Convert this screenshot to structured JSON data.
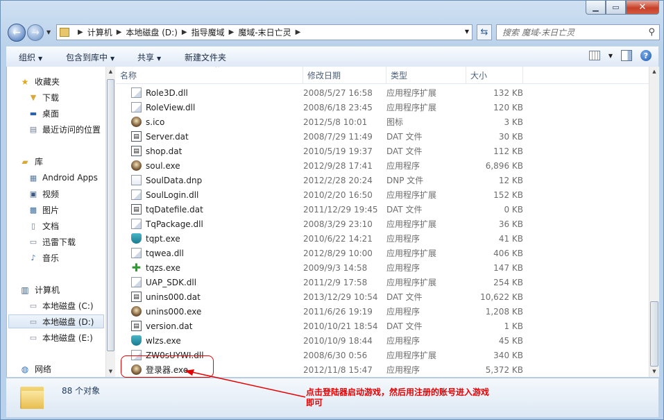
{
  "window": {
    "caption_min": "0",
    "caption_max": "1",
    "caption_close": "r"
  },
  "nav": {
    "breadcrumbs": [
      "计算机",
      "本地磁盘 (D:)",
      "指导魔域",
      "魔域-末日亡灵"
    ],
    "search_placeholder": "搜索 魔域-末日亡灵"
  },
  "toolbar": {
    "organize": "组织",
    "include_in_library": "包含到库中",
    "share": "共享",
    "new_folder": "新建文件夹"
  },
  "navpane": {
    "favorites": "收藏夹",
    "favorites_items": [
      "下载",
      "桌面",
      "最近访问的位置"
    ],
    "libraries": "库",
    "library_items": [
      "Android Apps",
      "视频",
      "图片",
      "文档",
      "迅雷下载",
      "音乐"
    ],
    "computer": "计算机",
    "computer_items": [
      "本地磁盘 (C:)",
      "本地磁盘 (D:)",
      "本地磁盘 (E:)"
    ],
    "network": "网络"
  },
  "columns": [
    "名称",
    "修改日期",
    "类型",
    "大小"
  ],
  "files": [
    {
      "name": "Role3D.dll",
      "date": "2008/5/27 16:58",
      "type": "应用程序扩展",
      "size": "132 KB",
      "icon": "dll"
    },
    {
      "name": "RoleView.dll",
      "date": "2008/6/18 23:45",
      "type": "应用程序扩展",
      "size": "120 KB",
      "icon": "dll"
    },
    {
      "name": "s.ico",
      "date": "2012/5/8 10:01",
      "type": "图标",
      "size": "3 KB",
      "icon": "game"
    },
    {
      "name": "Server.dat",
      "date": "2008/7/29 11:49",
      "type": "DAT 文件",
      "size": "30 KB",
      "icon": "dat"
    },
    {
      "name": "shop.dat",
      "date": "2010/5/19 19:37",
      "type": "DAT 文件",
      "size": "112 KB",
      "icon": "dat"
    },
    {
      "name": "soul.exe",
      "date": "2012/9/28 17:41",
      "type": "应用程序",
      "size": "6,896 KB",
      "icon": "game"
    },
    {
      "name": "SoulData.dnp",
      "date": "2012/2/28 20:24",
      "type": "DNP 文件",
      "size": "12 KB",
      "icon": "doc"
    },
    {
      "name": "SoulLogin.dll",
      "date": "2010/2/20 16:50",
      "type": "应用程序扩展",
      "size": "152 KB",
      "icon": "dll"
    },
    {
      "name": "tqDatefile.dat",
      "date": "2011/12/29 19:45",
      "type": "DAT 文件",
      "size": "0 KB",
      "icon": "dat"
    },
    {
      "name": "TqPackage.dll",
      "date": "2008/3/29 23:10",
      "type": "应用程序扩展",
      "size": "36 KB",
      "icon": "dll"
    },
    {
      "name": "tqpt.exe",
      "date": "2010/6/22 14:21",
      "type": "应用程序",
      "size": "41 KB",
      "icon": "shield"
    },
    {
      "name": "tqwea.dll",
      "date": "2012/8/29 10:00",
      "type": "应用程序扩展",
      "size": "406 KB",
      "icon": "dll"
    },
    {
      "name": "tqzs.exe",
      "date": "2009/9/3 14:58",
      "type": "应用程序",
      "size": "147 KB",
      "icon": "plus"
    },
    {
      "name": "UAP_SDK.dll",
      "date": "2011/2/9 17:58",
      "type": "应用程序扩展",
      "size": "254 KB",
      "icon": "dll"
    },
    {
      "name": "unins000.dat",
      "date": "2013/12/29 10:54",
      "type": "DAT 文件",
      "size": "10,622 KB",
      "icon": "dat"
    },
    {
      "name": "unins000.exe",
      "date": "2011/6/26 19:19",
      "type": "应用程序",
      "size": "1,208 KB",
      "icon": "game"
    },
    {
      "name": "version.dat",
      "date": "2010/10/21 18:54",
      "type": "DAT 文件",
      "size": "1 KB",
      "icon": "dat"
    },
    {
      "name": "wlzs.exe",
      "date": "2010/10/9 18:44",
      "type": "应用程序",
      "size": "45 KB",
      "icon": "shield"
    },
    {
      "name": "ZW0sUYWI.dll",
      "date": "2008/6/30 0:56",
      "type": "应用程序扩展",
      "size": "340 KB",
      "icon": "dll"
    },
    {
      "name": "登录器.exe",
      "date": "2012/11/8 15:47",
      "type": "应用程序",
      "size": "5,372 KB",
      "icon": "game"
    }
  ],
  "status": {
    "count": "88 个对象"
  },
  "annotation": {
    "line1": "点击登陆器启动游戏，然后用注册的账号进入游戏",
    "line2": "即可",
    "color": "#e60000"
  }
}
